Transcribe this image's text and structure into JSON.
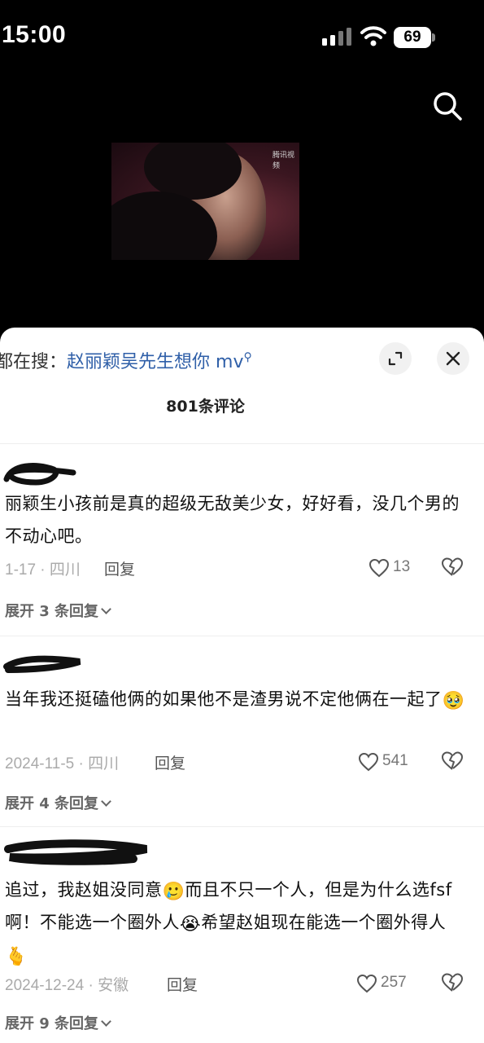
{
  "status_bar": {
    "time": "15:00",
    "battery": "69"
  },
  "video": {
    "watermark": "腾讯视频"
  },
  "sheet": {
    "search_prefix": "都在搜：",
    "search_query": "赵丽颖吴先生想你 mv",
    "comment_count_label": "801条评论"
  },
  "comments": [
    {
      "text": "丽颖生小孩前是真的超级无敌美少女，好好看，没几个男的不动心吧。",
      "meta": "1-17 · 四川",
      "reply_label": "回复",
      "likes": "13",
      "expand_label": "展开 3 条回复"
    },
    {
      "text_before": "当年我还挺磕他俩的如果他不是渣男说不定他俩在一起了",
      "emoji": "🥹",
      "meta": "2024-11-5 · 四川",
      "reply_label": "回复",
      "likes": "541",
      "expand_label": "展开 4 条回复"
    },
    {
      "text_part1": "追过，我赵姐没同意",
      "emoji1": "🥲",
      "text_part2": "而且不只一个人，但是为什么选fsf啊！不能选一个圈外人",
      "emoji2": "😭",
      "text_part3": "希望赵姐现在能选一个圈外得人",
      "emoji3": "🫰",
      "meta": "2024-12-24 · 安徽",
      "reply_label": "回复",
      "likes": "257",
      "expand_label": "展开 9 条回复"
    }
  ]
}
